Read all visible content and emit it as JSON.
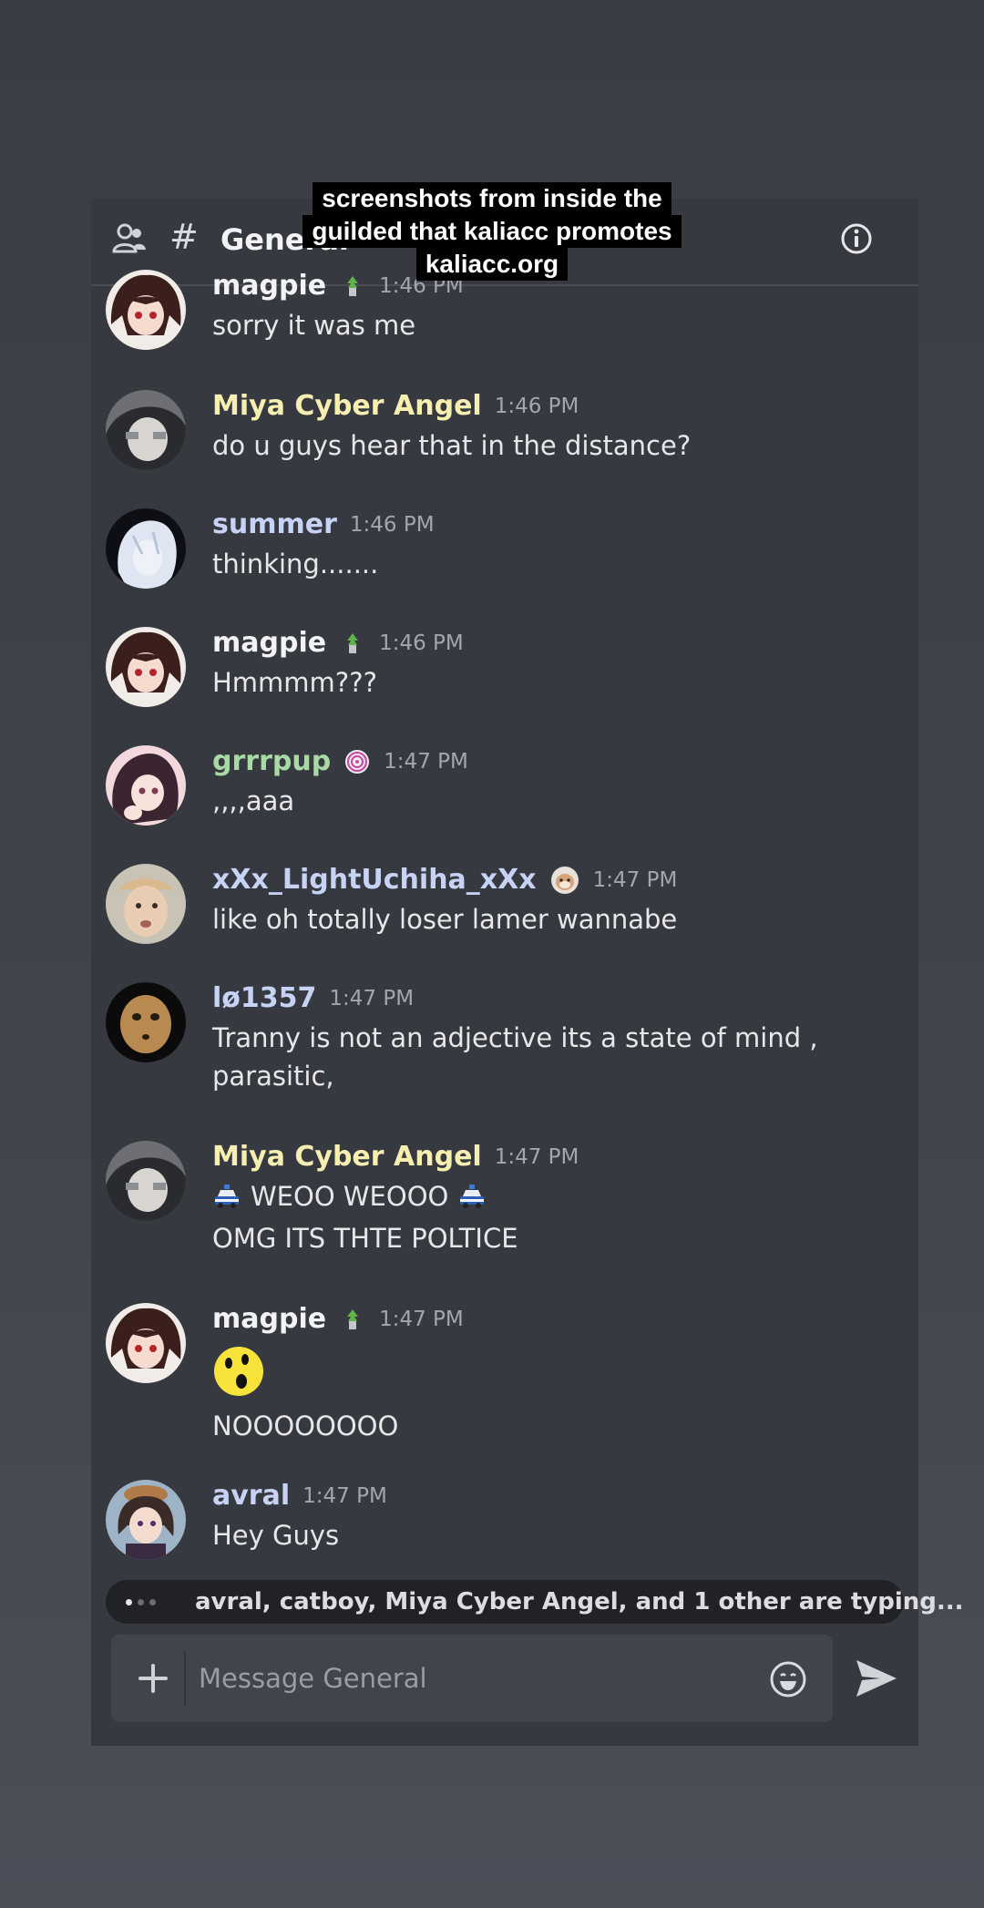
{
  "caption": {
    "line1": "screenshots from inside the",
    "line2": "guilded that kaliacc promotes",
    "line3": "kaliacc.org"
  },
  "header": {
    "hash": "#",
    "title": "General"
  },
  "messages": [
    {
      "user": "magpie",
      "time": "1:46 PM",
      "name_color": "#f2f3f5",
      "lines": [
        "sorry it was me"
      ]
    },
    {
      "user": "Miya Cyber Angel",
      "time": "1:46 PM",
      "name_color": "#f6efb0",
      "lines": [
        "do u guys hear that in the distance?"
      ]
    },
    {
      "user": "summer",
      "time": "1:46 PM",
      "name_color": "#c7d3f5",
      "lines": [
        "thinking......."
      ]
    },
    {
      "user": "magpie",
      "time": "1:46 PM",
      "name_color": "#f2f3f5",
      "lines": [
        "Hmmmm???"
      ]
    },
    {
      "user": "grrrpup",
      "time": "1:47 PM",
      "name_color": "#a9d9a5",
      "lines": [
        ",,,,aaa"
      ]
    },
    {
      "user": "xXx_LightUchiha_xXx",
      "time": "1:47 PM",
      "name_color": "#c7d3f5",
      "lines": [
        "like oh totally loser lamer wannabe"
      ]
    },
    {
      "user": "lø1357",
      "time": "1:47 PM",
      "name_color": "#c7d3f5",
      "lines": [
        "Tranny is not an adjective its a state of mind ,",
        "parasitic,"
      ]
    },
    {
      "user": "Miya Cyber Angel",
      "time": "1:47 PM",
      "name_color": "#f6efb0",
      "lines": [
        "WEOO WEOOO",
        "OMG ITS THTE POLTICE"
      ]
    },
    {
      "user": "magpie",
      "time": "1:47 PM",
      "name_color": "#f2f3f5",
      "lines": [
        "NOOOOOOOO"
      ]
    },
    {
      "user": "avral",
      "time": "1:47 PM",
      "name_color": "#c7d3f5",
      "lines": [
        "Hey Guys"
      ]
    }
  ],
  "typing_indicator": "avral, catboy, Miya Cyber Angel, and 1 other are typing...",
  "composer": {
    "placeholder": "Message General"
  },
  "colors": {
    "panel": "#36393f",
    "input": "#40444b",
    "typing_bg": "#202226"
  }
}
